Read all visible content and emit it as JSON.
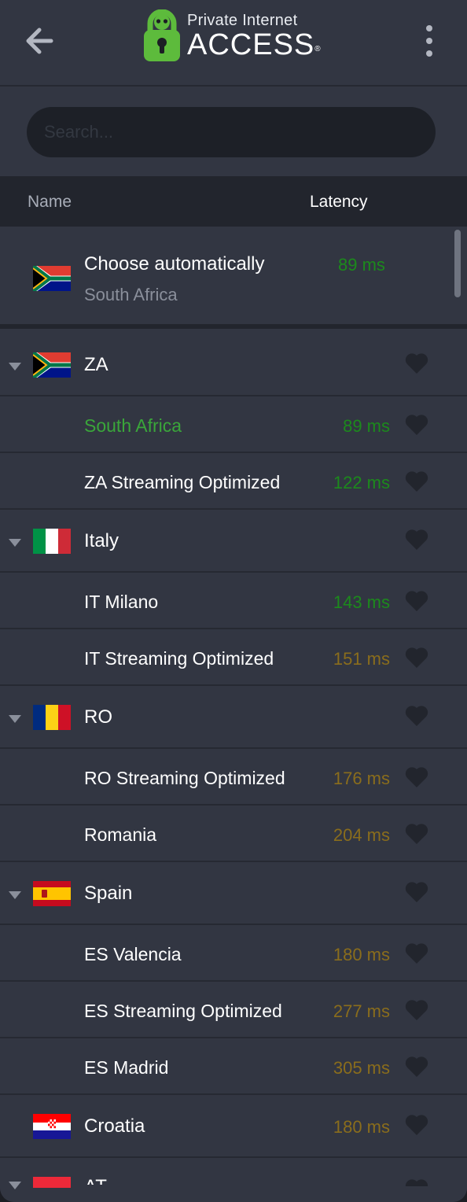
{
  "header": {
    "logo_small": "Private Internet",
    "logo_big": "ACCESS",
    "logo_mark": "®",
    "back_icon": "arrow-left-icon",
    "menu_icon": "vertical-dots-icon"
  },
  "search": {
    "placeholder": "Search...",
    "value": ""
  },
  "columns": {
    "name": "Name",
    "latency": "Latency"
  },
  "auto": {
    "title": "Choose automatically",
    "subtitle": "South Africa",
    "latency": "89 ms",
    "flag": "za"
  },
  "colors": {
    "latency_good": "#1c8a1c",
    "latency_medium": "#8a6d1c",
    "selected_text": "#3aa63a",
    "background": "#323642",
    "header_bar": "#22252d"
  },
  "regions": [
    {
      "type": "group",
      "label": "ZA",
      "flag": "za",
      "expanded": true
    },
    {
      "type": "sub",
      "label": "South Africa",
      "latency": "89 ms",
      "quality": "good",
      "selected": true
    },
    {
      "type": "sub",
      "label": "ZA Streaming Optimized",
      "latency": "122 ms",
      "quality": "good"
    },
    {
      "type": "group",
      "label": "Italy",
      "flag": "it",
      "expanded": true
    },
    {
      "type": "sub",
      "label": "IT Milano",
      "latency": "143 ms",
      "quality": "good"
    },
    {
      "type": "sub",
      "label": "IT Streaming Optimized",
      "latency": "151 ms",
      "quality": "medium"
    },
    {
      "type": "group",
      "label": "RO",
      "flag": "ro",
      "expanded": true
    },
    {
      "type": "sub",
      "label": "RO Streaming Optimized",
      "latency": "176 ms",
      "quality": "medium"
    },
    {
      "type": "sub",
      "label": "Romania",
      "latency": "204 ms",
      "quality": "medium"
    },
    {
      "type": "group",
      "label": "Spain",
      "flag": "es",
      "expanded": true
    },
    {
      "type": "sub",
      "label": "ES Valencia",
      "latency": "180 ms",
      "quality": "medium"
    },
    {
      "type": "sub",
      "label": "ES Streaming Optimized",
      "latency": "277 ms",
      "quality": "medium"
    },
    {
      "type": "sub",
      "label": "ES Madrid",
      "latency": "305 ms",
      "quality": "medium"
    },
    {
      "type": "single",
      "label": "Croatia",
      "flag": "hr",
      "latency": "180 ms",
      "quality": "medium"
    },
    {
      "type": "partial",
      "label": "AT",
      "flag": "at"
    }
  ]
}
